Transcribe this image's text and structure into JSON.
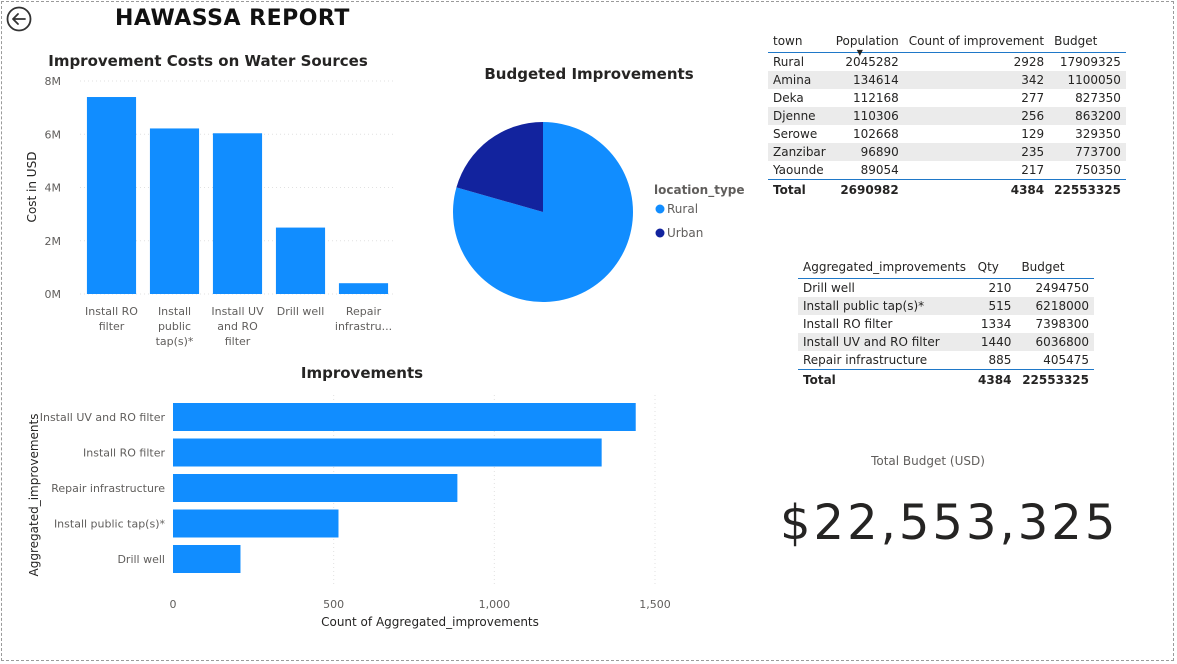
{
  "report": {
    "title": "HAWASSA REPORT"
  },
  "colors": {
    "primary": "#118dff",
    "urban": "#12239e",
    "header_rule": "#1f78c8"
  },
  "chart_data": [
    {
      "id": "improvement-costs",
      "type": "bar",
      "title": "Improvement Costs on Water Sources",
      "xlabel": "",
      "ylabel": "Cost in USD",
      "ylim": [
        0,
        8000000
      ],
      "yticks": [
        "0M",
        "2M",
        "4M",
        "6M",
        "8M"
      ],
      "categories": [
        [
          "Install RO",
          "filter"
        ],
        [
          "Install",
          "public",
          "tap(s)*"
        ],
        [
          "Install UV",
          "and RO",
          "filter"
        ],
        [
          "Drill well"
        ],
        [
          "Repair",
          "infrastru..."
        ]
      ],
      "values": [
        7398300,
        6218000,
        6036800,
        2494750,
        405475
      ]
    },
    {
      "id": "budgeted-improvements",
      "type": "pie",
      "title": "Budgeted Improvements",
      "legend_title": "location_type",
      "slices": [
        {
          "name": "Rural",
          "value": 17909325,
          "color": "#118dff"
        },
        {
          "name": "Urban",
          "value": 4644000,
          "color": "#12239e"
        }
      ]
    },
    {
      "id": "improvements",
      "type": "bar",
      "orientation": "horizontal",
      "title": "Improvements",
      "xlabel": "Count of Aggregated_improvements",
      "ylabel": "Aggregated_improvements",
      "xlim": [
        0,
        1500
      ],
      "xticks": [
        "0",
        "500",
        "1,000",
        "1,500"
      ],
      "categories": [
        "Install UV and RO filter",
        "Install RO filter",
        "Repair infrastructure",
        "Install public tap(s)*",
        "Drill well"
      ],
      "values": [
        1440,
        1334,
        885,
        515,
        210
      ]
    }
  ],
  "town_table": {
    "headers": [
      "town",
      "Population",
      "Count of improvement",
      "Budget"
    ],
    "rows": [
      [
        "Rural",
        "2045282",
        "2928",
        "17909325"
      ],
      [
        "Amina",
        "134614",
        "342",
        "1100050"
      ],
      [
        "Deka",
        "112168",
        "277",
        "827350"
      ],
      [
        "Djenne",
        "110306",
        "256",
        "863200"
      ],
      [
        "Serowe",
        "102668",
        "129",
        "329350"
      ],
      [
        "Zanzibar",
        "96890",
        "235",
        "773700"
      ],
      [
        "Yaounde",
        "89054",
        "217",
        "750350"
      ]
    ],
    "total": [
      "Total",
      "2690982",
      "4384",
      "22553325"
    ]
  },
  "agg_table": {
    "headers": [
      "Aggregated_improvements",
      "Qty",
      "Budget"
    ],
    "rows": [
      [
        "Drill well",
        "210",
        "2494750"
      ],
      [
        "Install public tap(s)*",
        "515",
        "6218000"
      ],
      [
        "Install RO filter",
        "1334",
        "7398300"
      ],
      [
        "Install UV and RO filter",
        "1440",
        "6036800"
      ],
      [
        "Repair infrastructure",
        "885",
        "405475"
      ]
    ],
    "total": [
      "Total",
      "4384",
      "22553325"
    ]
  },
  "kpi": {
    "label": "Total Budget (USD)",
    "value": "$22,553,325"
  }
}
